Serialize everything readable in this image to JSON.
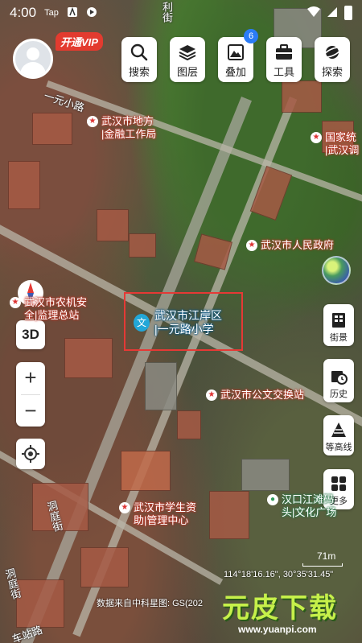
{
  "status_bar": {
    "time": "4:00",
    "icons": [
      "tap-icon",
      "a-icon",
      "shield-icon"
    ],
    "right_icons": [
      "wifi-icon",
      "signal-icon",
      "battery-icon"
    ],
    "tap_text": "Tap"
  },
  "account": {
    "vip_label": "开通VIP"
  },
  "toolbar": [
    {
      "label": "搜索",
      "icon": "search-icon"
    },
    {
      "label": "图层",
      "icon": "layers-icon"
    },
    {
      "label": "叠加",
      "icon": "overlay-icon",
      "badge": "6"
    },
    {
      "label": "工具",
      "icon": "toolbox-icon"
    },
    {
      "label": "探索",
      "icon": "planet-icon"
    }
  ],
  "side_tools": [
    {
      "label": "街景",
      "icon": "street-view-icon"
    },
    {
      "label": "历史",
      "icon": "history-icon"
    },
    {
      "label": "等高线",
      "icon": "contour-icon"
    },
    {
      "label": "更多",
      "icon": "more-grid-icon"
    }
  ],
  "left_controls": {
    "view_3d": "3D",
    "zoom_in": "+",
    "zoom_out": "−"
  },
  "map": {
    "road_labels": [
      "一元小路",
      "洞庭街",
      "洞庭街",
      "车站路",
      "利街"
    ],
    "pois": [
      {
        "line1": "武汉市地方",
        "line2": "|金融工作局"
      },
      {
        "line1": "国家统",
        "line2": "|武汉调"
      },
      {
        "line1": "武汉市人民政府",
        "line2": ""
      },
      {
        "line1": "武汉市公文交换站",
        "line2": ""
      },
      {
        "line1": "武汉市学生资",
        "line2": "助|管理中心"
      },
      {
        "line1": "汉口江滩码",
        "line2": "头|文化广场"
      },
      {
        "line1": "武汉市农机安",
        "line2": "全|监理总站"
      }
    ],
    "selected": {
      "line1": "武汉市江岸区",
      "line2": "|一元路小学",
      "pin": "文"
    },
    "scale": "71m",
    "coordinates": "114°18'16.16\", 30°35'31.45\"",
    "source": "数据来自中科星图: GS(202"
  },
  "watermark": {
    "big": "元皮下载",
    "small": "www.yuanpi.com"
  }
}
